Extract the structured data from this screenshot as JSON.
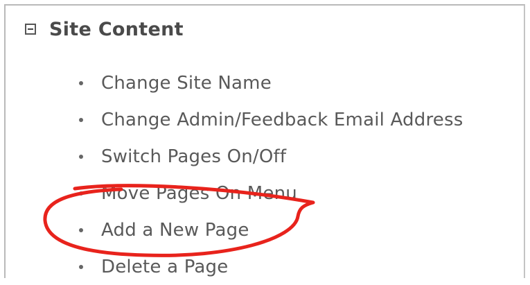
{
  "panel": {
    "title": "Site Content",
    "toggle_icon": "minus-box-icon"
  },
  "menu": {
    "items": [
      {
        "label": "Change Site Name"
      },
      {
        "label": "Change Admin/Feedback Email Address"
      },
      {
        "label": "Switch Pages On/Off"
      },
      {
        "label": "Move Pages On Menu"
      },
      {
        "label": "Add a New Page"
      },
      {
        "label": "Delete a Page"
      }
    ]
  },
  "annotation": {
    "color": "#e8231c",
    "highlighted_item": "Add a New Page"
  }
}
